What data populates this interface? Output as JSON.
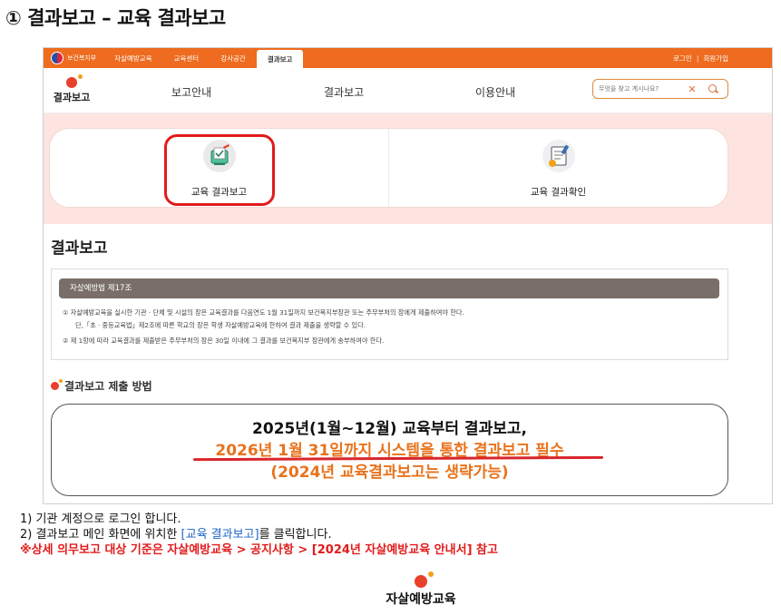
{
  "slide": {
    "title": "① 결과보고 – 교육 결과보고"
  },
  "topbar": {
    "gov_label": "보건복지부",
    "nav": [
      "자살예방교육",
      "교육센터",
      "강사공간",
      "결과보고"
    ],
    "active_nav": "결과보고",
    "login": "로그인",
    "separator": "|",
    "signup": "회원가입",
    "accent_color": "#ee6b1f"
  },
  "header": {
    "logo_text": "결과보고",
    "menu": [
      "보고안내",
      "결과보고",
      "이용안내"
    ],
    "search": {
      "placeholder": "무엇을 찾고 계시나요?",
      "clear": "✕"
    }
  },
  "cards": [
    {
      "label": "교육 결과보고",
      "icon": "report-edit-icon",
      "highlighted": true
    },
    {
      "label": "교육 결과확인",
      "icon": "report-check-icon",
      "highlighted": false
    }
  ],
  "section": {
    "title": "결과보고"
  },
  "law": {
    "title": "자살예방법 제17조",
    "line1": "① 자살예방교육을 실시한 기관 · 단체 및 시설의 장은 교육결과를 다음연도 1월 31일까지 보건복지부장관 또는 주무부처의 장에게 제출하여야 한다.",
    "line2": "단,「초 · 중등교육법」제2조에 따른 학교의 장은 학생 자살예방교육에 한하여 결과 제출을 생략할 수 있다.",
    "line3": "② 제 1항에 따라 교육결과를 제출받은 주무부처의 장은 30일 이내에 그 결과를 보건복지부 장관에게 송부하여야 한다."
  },
  "submission": {
    "title": "결과보고 제출 방법",
    "line1": "2025년(1월~12월) 교육부터 결과보고,",
    "line2": "2026년 1월 31일까지 시스템을 통한 결과보고 필수",
    "line3": "(2024년 교육결과보고는 생략가능)"
  },
  "steps": {
    "s1": "1)  기관 계정으로 로그인 합니다.",
    "s2_pre": "2)  결과보고 메인 화면에 위치한 ",
    "s2_link": "[교육 결과보고]",
    "s2_post": "를 클릭합니다.",
    "note": "※상세 의무보고 대상 기준은 자살예방교육 > 공지사항 > [2024년 자살예방교육 안내서] 참고"
  },
  "footer": {
    "logo_text": "자살예방교육"
  }
}
